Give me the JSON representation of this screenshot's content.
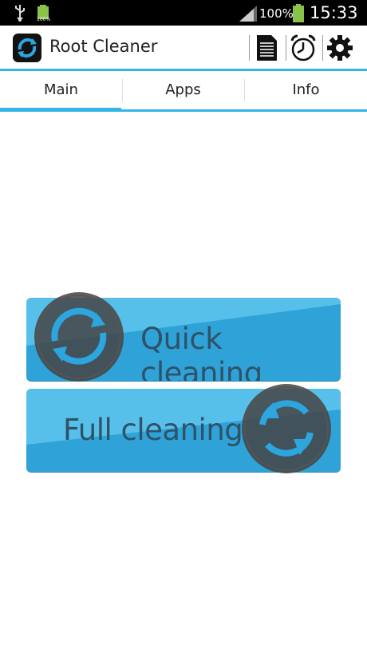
{
  "status_bar": {
    "battery_small_text": "100%",
    "battery_percent": "100%",
    "time": "15:33"
  },
  "action_bar": {
    "title": "Root Cleaner",
    "accent": "#33b5e5"
  },
  "tabs": [
    {
      "label": "Main",
      "selected": true
    },
    {
      "label": "Apps",
      "selected": false
    },
    {
      "label": "Info",
      "selected": false
    }
  ],
  "buttons": {
    "quick_label": "Quick cleaning",
    "full_label": "Full cleaning"
  },
  "icons": {
    "usb": "usb-icon",
    "battery": "battery-icon",
    "signal": "signal-icon",
    "log": "document-icon",
    "schedule": "alarm-clock-icon",
    "settings": "gear-icon"
  }
}
